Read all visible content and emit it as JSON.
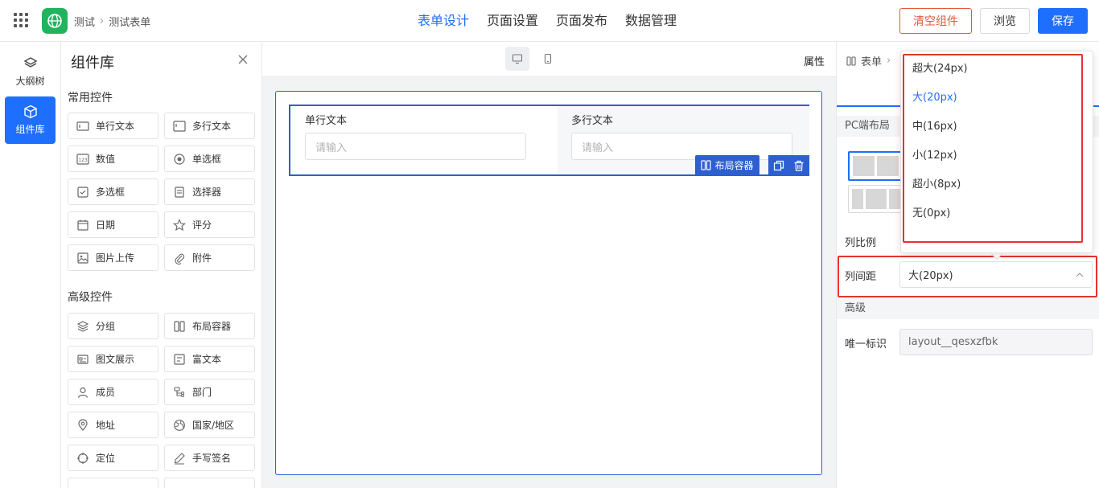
{
  "topbar": {
    "breadcrumb": [
      "测试",
      "测试表单"
    ],
    "tabs": [
      "表单设计",
      "页面设置",
      "页面发布",
      "数据管理"
    ],
    "active_tab": 0,
    "clear_btn": "清空组件",
    "preview_btn": "浏览",
    "save_btn": "保存"
  },
  "rail": {
    "items": [
      {
        "label": "大纲树",
        "icon": "layers-icon"
      },
      {
        "label": "组件库",
        "icon": "cube-icon"
      }
    ],
    "active": 1
  },
  "library": {
    "title": "组件库",
    "common_title": "常用控件",
    "common": [
      {
        "label": "单行文本",
        "icon": "input-icon"
      },
      {
        "label": "多行文本",
        "icon": "textarea-icon"
      },
      {
        "label": "数值",
        "icon": "number-icon"
      },
      {
        "label": "单选框",
        "icon": "radio-icon"
      },
      {
        "label": "多选框",
        "icon": "checkbox-icon"
      },
      {
        "label": "选择器",
        "icon": "select-icon"
      },
      {
        "label": "日期",
        "icon": "calendar-icon"
      },
      {
        "label": "评分",
        "icon": "star-icon"
      },
      {
        "label": "图片上传",
        "icon": "image-icon"
      },
      {
        "label": "附件",
        "icon": "paperclip-icon"
      }
    ],
    "advanced_title": "高级控件",
    "advanced": [
      {
        "label": "分组",
        "icon": "layers-icon"
      },
      {
        "label": "布局容器",
        "icon": "columns-icon"
      },
      {
        "label": "图文展示",
        "icon": "media-icon"
      },
      {
        "label": "富文本",
        "icon": "richtext-icon"
      },
      {
        "label": "成员",
        "icon": "user-icon"
      },
      {
        "label": "部门",
        "icon": "org-icon"
      },
      {
        "label": "地址",
        "icon": "pin-icon"
      },
      {
        "label": "国家/地区",
        "icon": "globe-icon"
      },
      {
        "label": "定位",
        "icon": "target-icon"
      },
      {
        "label": "手写签名",
        "icon": "pen-icon"
      }
    ]
  },
  "canvas": {
    "attr_label": "属性",
    "fields": [
      {
        "label": "单行文本",
        "placeholder": "请输入"
      },
      {
        "label": "多行文本",
        "placeholder": "请输入"
      }
    ],
    "layout_tag": "布局容器"
  },
  "right_panel": {
    "crumb": "表单",
    "pc_layout": "PC端布局",
    "col_ratio": "列比例",
    "col_gap": "列间距",
    "col_gap_value": "大(20px)",
    "advanced": "高级",
    "unique_id_label": "唯一标识",
    "unique_id_value": "layout__qesxzfbk"
  },
  "dropdown": {
    "options": [
      "超大(24px)",
      "大(20px)",
      "中(16px)",
      "小(12px)",
      "超小(8px)",
      "无(0px)"
    ],
    "selected": 1
  },
  "colors": {
    "accent": "#1f6fff",
    "danger": "#e4573a",
    "highlight": "#e5322f",
    "logo": "#22b35e"
  }
}
